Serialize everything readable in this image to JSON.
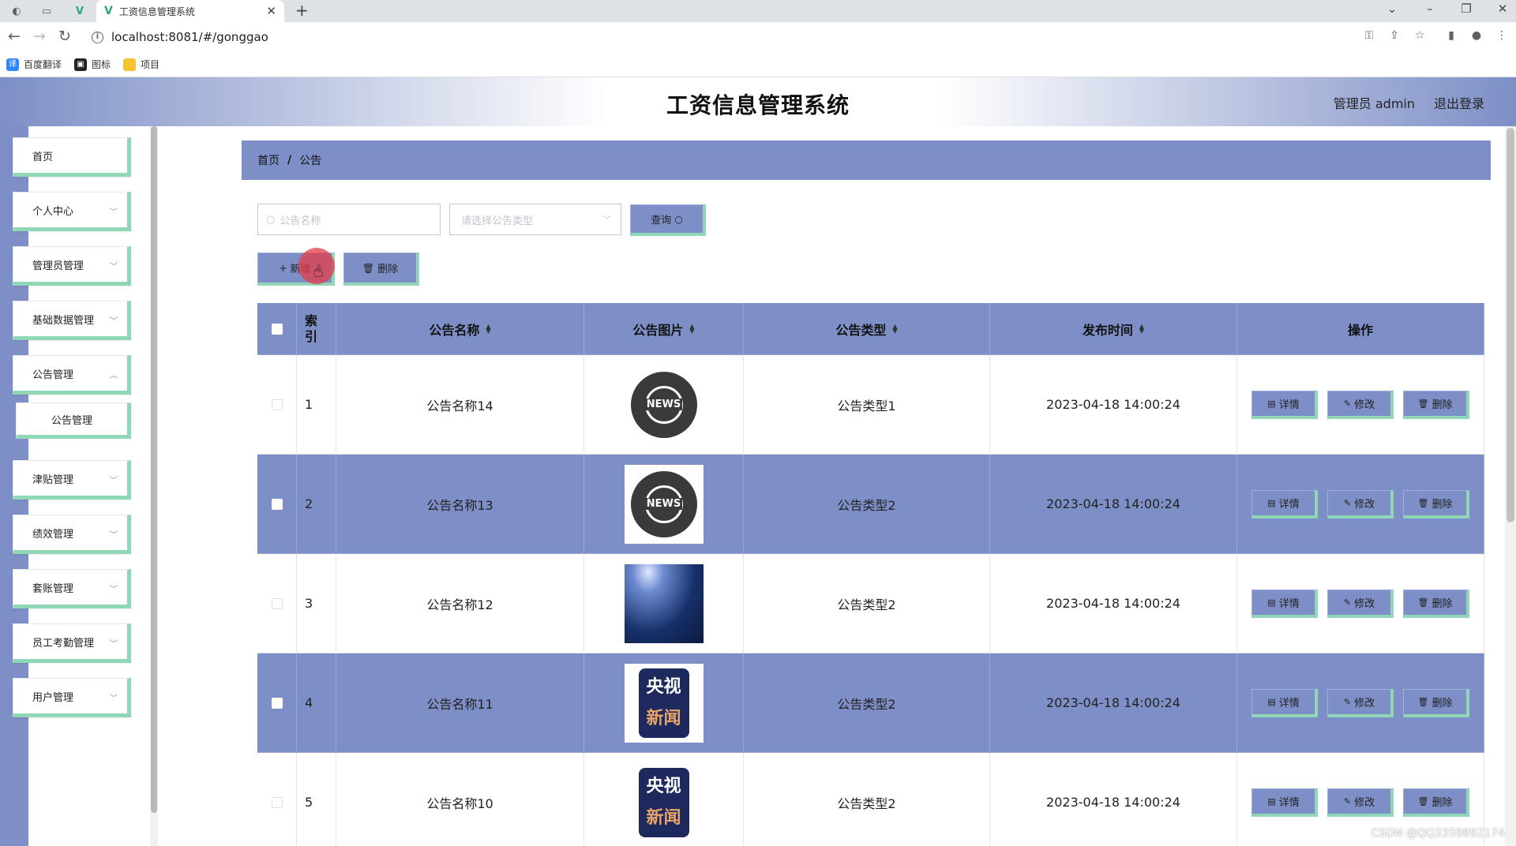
{
  "browser": {
    "tab_title": "工资信息管理系统",
    "url": "localhost:8081/#/gonggao",
    "bookmarks": [
      {
        "label": "百度翻译",
        "color": "#3385ff"
      },
      {
        "label": "图标",
        "color": "#222222"
      },
      {
        "label": "项目",
        "color": "#f4c430"
      }
    ]
  },
  "header": {
    "title": "工资信息管理系统",
    "user_label": "管理员 admin",
    "logout": "退出登录"
  },
  "sidebar": {
    "items": [
      {
        "label": "首页"
      },
      {
        "label": "个人中心"
      },
      {
        "label": "管理员管理"
      },
      {
        "label": "基础数据管理"
      },
      {
        "label": "公告管理"
      },
      {
        "label": "公告管理"
      },
      {
        "label": "津贴管理"
      },
      {
        "label": "绩效管理"
      },
      {
        "label": "套账管理"
      },
      {
        "label": "员工考勤管理"
      },
      {
        "label": "用户管理"
      }
    ]
  },
  "breadcrumb": {
    "home": "首页",
    "current": "公告"
  },
  "search": {
    "name_placeholder": "公告名称",
    "type_placeholder": "请选择公告类型",
    "query_button": "查询"
  },
  "actions": {
    "add": "新增",
    "delete": "删除"
  },
  "table": {
    "columns": {
      "index": "索引",
      "name": "公告名称",
      "image": "公告图片",
      "type": "公告类型",
      "time": "发布时间",
      "ops": "操作"
    },
    "ops": {
      "detail": "详情",
      "edit": "修改",
      "delete": "删除"
    },
    "rows": [
      {
        "index": "1",
        "name": "公告名称14",
        "image": "news-globe-dark",
        "type": "公告类型1",
        "time": "2023-04-18 14:00:24"
      },
      {
        "index": "2",
        "name": "公告名称13",
        "image": "news-globe-white",
        "type": "公告类型2",
        "time": "2023-04-18 14:00:24"
      },
      {
        "index": "3",
        "name": "公告名称12",
        "image": "stage-spotlight",
        "type": "公告类型2",
        "time": "2023-04-18 14:00:24"
      },
      {
        "index": "4",
        "name": "公告名称11",
        "image": "cctv-news",
        "type": "公告类型2",
        "time": "2023-04-18 14:00:24"
      },
      {
        "index": "5",
        "name": "公告名称10",
        "image": "cctv-news",
        "type": "公告类型2",
        "time": "2023-04-18 14:00:24"
      }
    ]
  },
  "watermark": "CSDN @QQ3359892174",
  "colors": {
    "primary": "#7d8fc6",
    "accent": "#8fd7b7"
  }
}
